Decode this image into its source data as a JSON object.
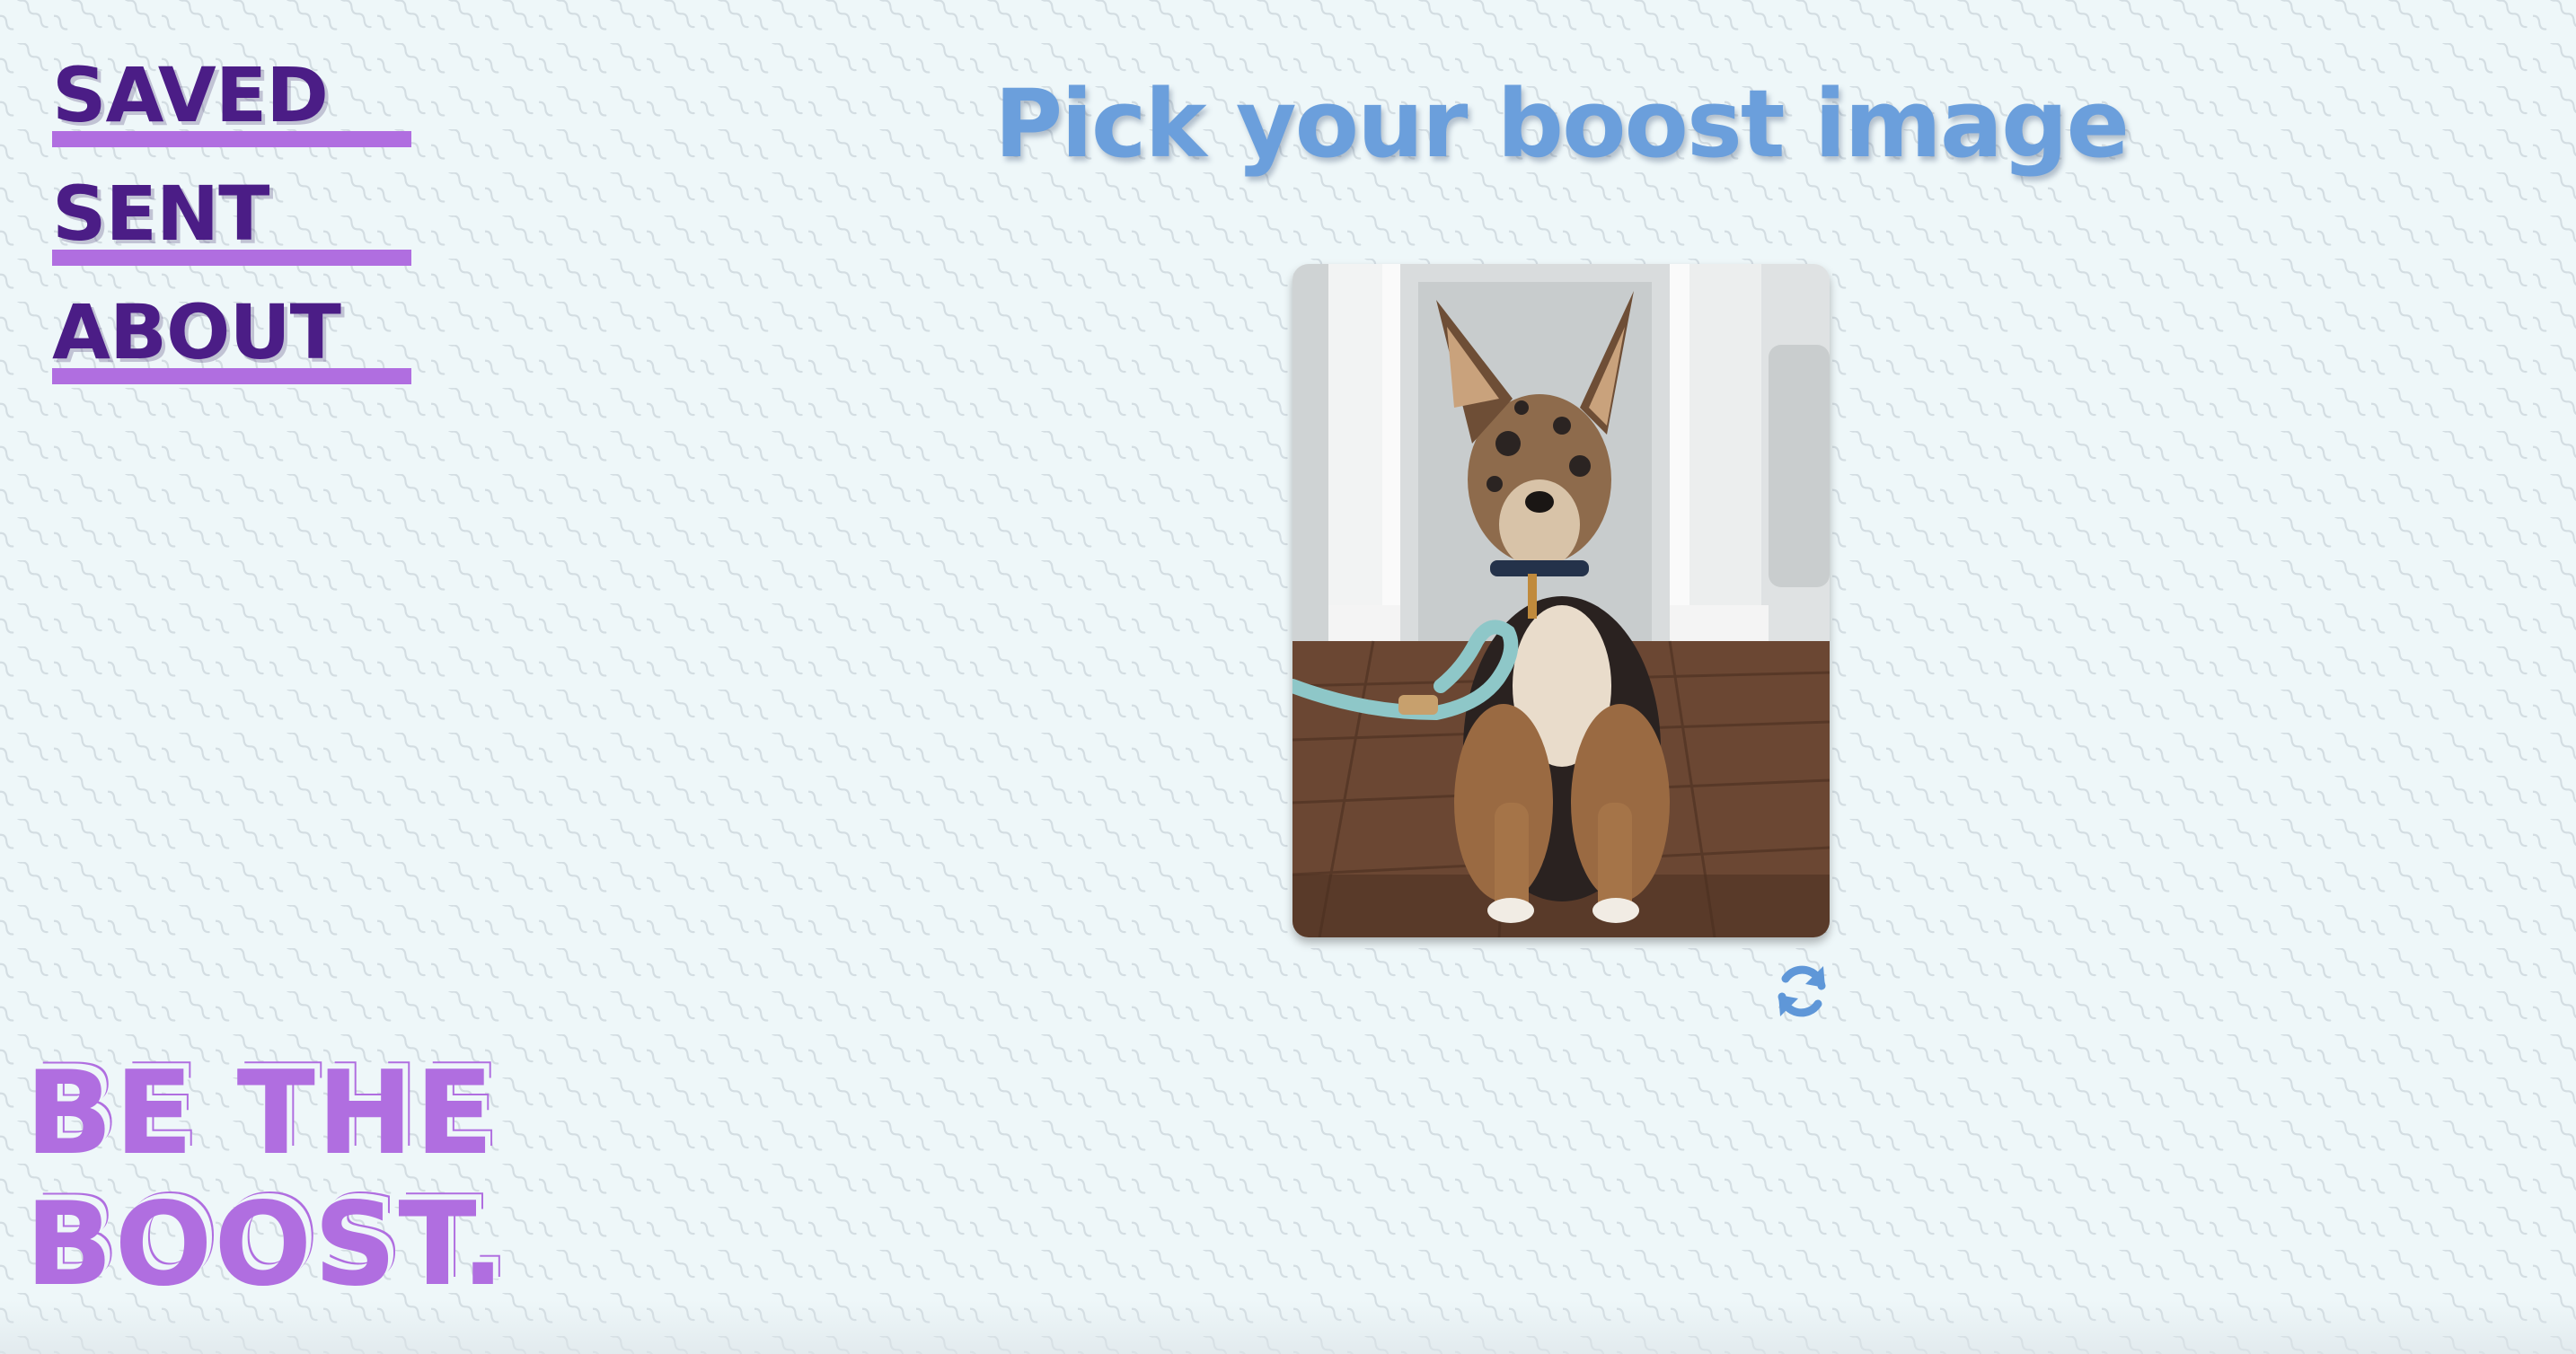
{
  "nav": {
    "items": [
      {
        "label": "SAVED"
      },
      {
        "label": "SENT"
      },
      {
        "label": "ABOUT"
      }
    ]
  },
  "slogan": {
    "line1": "BE THE",
    "line2": "BOOST."
  },
  "main": {
    "title": "Pick your boost image",
    "image_subject": "dog-photo",
    "refresh_icon": "refresh-icon"
  },
  "colors": {
    "nav_text": "#4b1d86",
    "nav_underline": "#b06ee0",
    "title": "#6b9fdc",
    "slogan": "#b06ee0",
    "background": "#eef7f9"
  }
}
